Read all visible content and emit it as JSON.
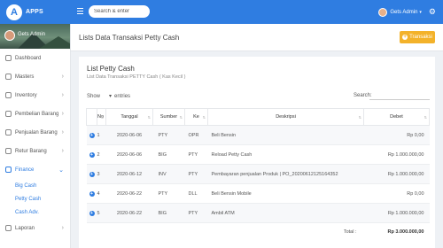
{
  "topbar": {
    "brand_letter": "A",
    "brand_name": "APPS",
    "search_placeholder": "Search & enter",
    "user_name": "Gets Admin",
    "caret": "▾",
    "gear": "⚙"
  },
  "sidebar": {
    "profile_name": "Gets Admin",
    "items": [
      {
        "label": "Dashboard",
        "chev": ""
      },
      {
        "label": "Masters",
        "chev": "›"
      },
      {
        "label": "Inventory",
        "chev": "›"
      },
      {
        "label": "Pembelian Barang",
        "chev": "›"
      },
      {
        "label": "Penjualan Barang",
        "chev": "›"
      },
      {
        "label": "Retur Barang",
        "chev": "›"
      },
      {
        "label": "Finance",
        "chev": "⌄"
      }
    ],
    "sub_items": [
      "Big Cash",
      "Petty Cash",
      "Cash Adv."
    ],
    "last_item": {
      "label": "Laporan",
      "chev": "›"
    }
  },
  "header": {
    "title": "Lists Data Transaksi Petty Cash",
    "add_button": "Transaksi",
    "add_icon": "+"
  },
  "card": {
    "title": "List Petty Cash",
    "subtitle": "List Data Transaksi PETTY Cash ( Kas Kecil )",
    "show_label": "Show",
    "show_value": "▾",
    "entries_label": "entries",
    "search_label": "Search:"
  },
  "table": {
    "headers": {
      "no": "No",
      "tanggal": "Tanggal",
      "sumber": "Sumber",
      "ke": "Ke",
      "deskripsi": "Deskripsi",
      "debet": "Debet"
    },
    "row_icon": "+",
    "rows": [
      {
        "no": "1",
        "tanggal": "2020-06-06",
        "sumber": "PTY",
        "ke": "OPR",
        "deskripsi": "Beli Bensin",
        "debet": "Rp 0,00"
      },
      {
        "no": "2",
        "tanggal": "2020-06-06",
        "sumber": "BIG",
        "ke": "PTY",
        "deskripsi": "Reload Petty Cash",
        "debet": "Rp 1.000.000,00"
      },
      {
        "no": "3",
        "tanggal": "2020-06-12",
        "sumber": "INV",
        "ke": "PTY",
        "deskripsi": "Pembayaran penjualan Produk | PO_20200612125164352",
        "debet": "Rp 1.000.000,00"
      },
      {
        "no": "4",
        "tanggal": "2020-06-22",
        "sumber": "PTY",
        "ke": "DLL",
        "deskripsi": "Beli Bensin Mobile",
        "debet": "Rp 0,00"
      },
      {
        "no": "5",
        "tanggal": "2020-06-22",
        "sumber": "BIG",
        "ke": "PTY",
        "deskripsi": "Ambil ATM",
        "debet": "Rp 1.000.000,00"
      }
    ],
    "total_label": "Total :",
    "total_value": "Rp 3.000.000,00"
  }
}
